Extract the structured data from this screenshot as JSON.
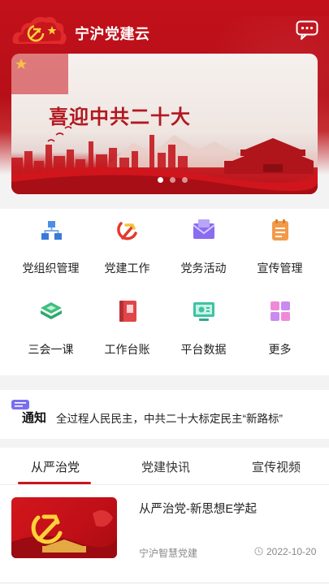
{
  "app": {
    "title": "宁沪党建云"
  },
  "header": {
    "message_icon": "chat-bubble-icon"
  },
  "banner": {
    "headline": "喜迎中共二十大",
    "slides": 3,
    "active_slide": 1
  },
  "menu": [
    {
      "label": "党组织管理",
      "icon": "org-chart-icon"
    },
    {
      "label": "党建工作",
      "icon": "party-emblem-icon"
    },
    {
      "label": "党务活动",
      "icon": "mail-icon"
    },
    {
      "label": "宣传管理",
      "icon": "notepad-icon"
    },
    {
      "label": "三会一课",
      "icon": "book-stack-icon"
    },
    {
      "label": "工作台账",
      "icon": "ledger-icon"
    },
    {
      "label": "平台数据",
      "icon": "monitor-icon"
    },
    {
      "label": "更多",
      "icon": "more-grid-icon"
    }
  ],
  "notice": {
    "label": "通知",
    "text": "全过程人民民主，中共二十大标定民主“新路标”"
  },
  "tabs": [
    {
      "label": "从严治党"
    },
    {
      "label": "党建快讯"
    },
    {
      "label": "宣传视频"
    }
  ],
  "active_tab": 0,
  "articles": [
    {
      "title": "从严治党-新思想E学起",
      "source": "宁沪智慧党建",
      "date": "2022-10-20"
    }
  ],
  "colors": {
    "brand_red": "#c2111b",
    "accent": "#c8161d"
  }
}
